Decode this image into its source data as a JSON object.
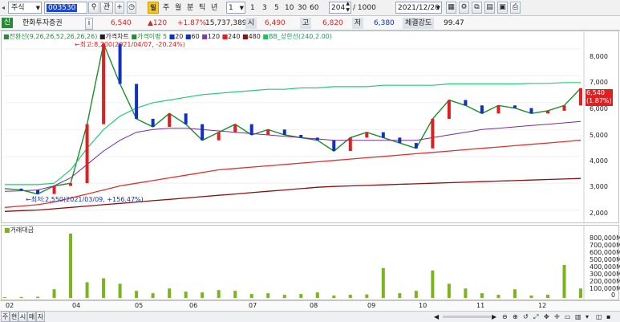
{
  "toolbar": {
    "market": "주식",
    "code": "003530",
    "edit_label": "관",
    "plus_label": "+",
    "period_tabs": [
      "주",
      "월",
      "분",
      "틱",
      "년"
    ],
    "multiplier": "1",
    "minute_options": [
      "1",
      "3",
      "5",
      "10",
      "30",
      "60"
    ],
    "count": "204",
    "max_count": "/ 1000",
    "date": "2021/12/20"
  },
  "info": {
    "tag": "신",
    "name": "한화투자증권",
    "i_label": "i",
    "price": "6,540",
    "change": "▲120",
    "change_pct": "+1.87%",
    "volume": "15,737,389",
    "open_label": "시",
    "open": "6,490",
    "high_label": "고",
    "high": "6,820",
    "low_label": "저",
    "low": "6,380",
    "strength_label": "체결강도",
    "strength": "99.47"
  },
  "legend": {
    "ichimoku": "전환선(9,26,26,52,26,26,26)",
    "price_chart": "가격차트",
    "ma_label": "가격이평",
    "ma_periods": [
      "5",
      "20",
      "60",
      "120",
      "240",
      "480"
    ],
    "bb": "BB_상한선(240,2.00)"
  },
  "annotations": {
    "high": "←최고:8,200(2021/04/07, -20.24%)",
    "low": "←최저:2,550(2021/03/09, +156.47%)"
  },
  "price_axis": {
    "ticks": [
      "8,000",
      "7,000",
      "6,000",
      "5,000",
      "4,000",
      "3,000",
      "2,000"
    ]
  },
  "current_price_tag": {
    "price": "6,540",
    "pct": "(1.87%)"
  },
  "volume_panel": {
    "label": "거래대금",
    "ticks": [
      "800,000M",
      "700,000M",
      "600,000M",
      "500,000M",
      "400,000M",
      "300,000M",
      "200,000M",
      "100,000M",
      "0"
    ]
  },
  "x_axis": {
    "labels": [
      "02",
      "04",
      "05",
      "06",
      "07",
      "08",
      "09",
      "10",
      "11",
      "12"
    ]
  },
  "bottom_tabs": [
    "주",
    "현",
    "시",
    "매",
    "자"
  ],
  "chart_data": [
    {
      "type": "line",
      "title": "",
      "x_months": [
        "02",
        "04",
        "05",
        "06",
        "07",
        "08",
        "09",
        "10",
        "11",
        "12"
      ],
      "ylim": [
        1600,
        8600
      ],
      "series": [
        {
          "name": "가격차트",
          "values": [
            2800,
            2750,
            2600,
            2900,
            3000,
            5200,
            8200,
            6700,
            5400,
            5100,
            5600,
            5200,
            4600,
            4900,
            5200,
            4800,
            5000,
            4800,
            4700,
            4600,
            4200,
            4700,
            4900,
            4700,
            4500,
            4300,
            5400,
            6100,
            5900,
            5600,
            5900,
            5800,
            5600,
            5700,
            5900,
            6540
          ]
        },
        {
          "name": "120",
          "values": [
            2700,
            2720,
            2750,
            2900,
            3200,
            3700,
            4200,
            4600,
            4900,
            5000,
            5050,
            5050,
            5000,
            4950,
            4900,
            4850,
            4800,
            4750,
            4700,
            4650,
            4600,
            4600,
            4600,
            4600,
            4600,
            4600,
            4700,
            4800,
            4900,
            5000,
            5050,
            5100,
            5150,
            5200,
            5250,
            5300
          ]
        },
        {
          "name": "BB_상한선(240,2.00)",
          "values": [
            2950,
            2950,
            2950,
            3000,
            3500,
            4300,
            5000,
            5500,
            5800,
            6000,
            6100,
            6200,
            6300,
            6350,
            6400,
            6450,
            6500,
            6500,
            6550,
            6550,
            6600,
            6600,
            6600,
            6650,
            6650,
            6650,
            6650,
            6700,
            6700,
            6700,
            6700,
            6700,
            6720,
            6720,
            6750,
            6750
          ]
        },
        {
          "name": "240",
          "values": [
            2100,
            2150,
            2200,
            2300,
            2450,
            2600,
            2750,
            2900,
            3000,
            3100,
            3200,
            3300,
            3400,
            3500,
            3550,
            3600,
            3650,
            3700,
            3750,
            3800,
            3850,
            3900,
            3950,
            4000,
            4050,
            4100,
            4150,
            4200,
            4250,
            4300,
            4350,
            4400,
            4450,
            4500,
            4550,
            4600
          ]
        },
        {
          "name": "480",
          "values": [
            1950,
            1980,
            2000,
            2050,
            2100,
            2150,
            2200,
            2250,
            2300,
            2350,
            2400,
            2450,
            2500,
            2550,
            2600,
            2650,
            2700,
            2750,
            2800,
            2850,
            2880,
            2900,
            2920,
            2940,
            2960,
            2980,
            3000,
            3020,
            3040,
            3060,
            3080,
            3100,
            3120,
            3140,
            3160,
            3180
          ]
        }
      ]
    },
    {
      "type": "bar",
      "title": "거래대금",
      "ylim": [
        0,
        900000
      ],
      "series": [
        {
          "name": "거래대금",
          "values": [
            9000,
            12000,
            15000,
            110000,
            820000,
            200000,
            250000,
            180000,
            90000,
            60000,
            120000,
            80000,
            70000,
            100000,
            90000,
            50000,
            60000,
            40000,
            50000,
            70000,
            30000,
            40000,
            45000,
            380000,
            60000,
            90000,
            350000,
            180000,
            120000,
            60000,
            40000,
            110000,
            30000,
            40000,
            420000,
            120000
          ]
        }
      ]
    }
  ]
}
